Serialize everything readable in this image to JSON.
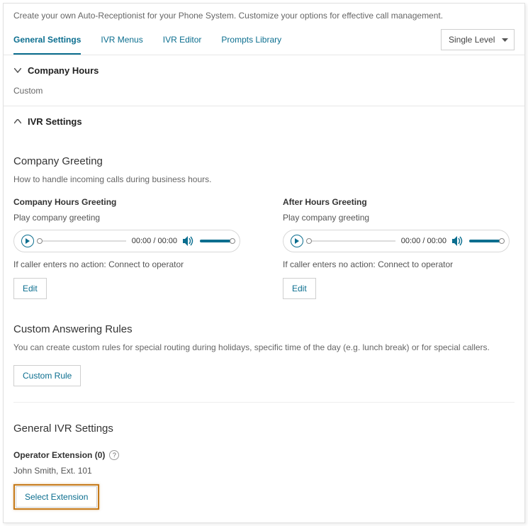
{
  "intro": "Create your own Auto-Receptionist for your Phone System. Customize your options for effective call management.",
  "tabs": {
    "general": "General Settings",
    "ivr_menus": "IVR Menus",
    "ivr_editor": "IVR Editor",
    "prompts": "Prompts Library"
  },
  "level_select": {
    "value": "Single Level"
  },
  "company_hours": {
    "title": "Company Hours",
    "value": "Custom"
  },
  "ivr": {
    "title": "IVR Settings",
    "greeting": {
      "heading": "Company Greeting",
      "sub": "How to handle incoming calls during business hours.",
      "company": {
        "title": "Company Hours Greeting",
        "line": "Play company greeting",
        "time": "00:00 / 00:00",
        "noaction": "If caller enters no action: Connect to operator",
        "edit": "Edit"
      },
      "after": {
        "title": "After Hours Greeting",
        "line": "Play company greeting",
        "time": "00:00 / 00:00",
        "noaction": "If caller enters no action: Connect to operator",
        "edit": "Edit"
      }
    },
    "rules": {
      "heading": "Custom Answering Rules",
      "sub": "You can create custom rules for special routing during holidays, specific time of the day (e.g. lunch break) or for special callers.",
      "button": "Custom Rule"
    },
    "general": {
      "heading": "General IVR Settings",
      "op_label": "Operator Extension (0)",
      "op_value": "John Smith, Ext. 101",
      "select_btn": "Select Extension"
    }
  }
}
